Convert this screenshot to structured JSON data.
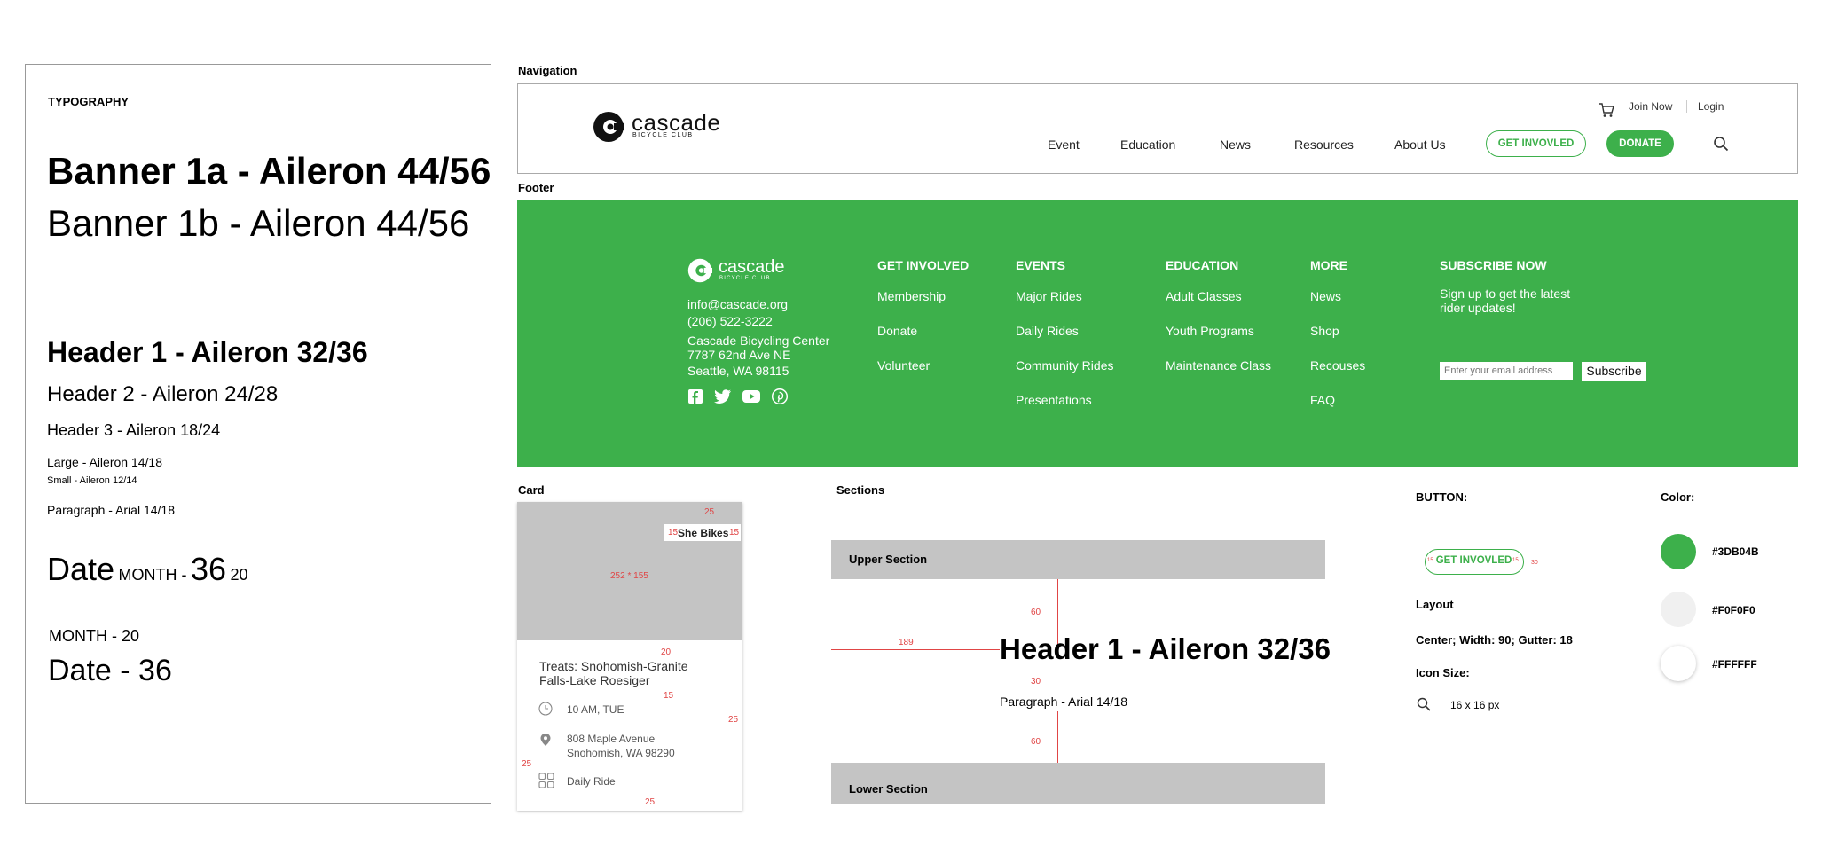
{
  "typography": {
    "title": "TYPOGRAPHY",
    "banner_1a": "Banner 1a - Aileron 44/56",
    "banner_1b": "Banner 1b - Aileron 44/56",
    "header_1": "Header 1 - Aileron 32/36",
    "header_2": "Header 2 - Aileron 24/28",
    "header_3": "Header 3 - Aileron 18/24",
    "large": "Large - Aileron 14/18",
    "small": "Small - Aileron 12/14",
    "paragraph": "Paragraph - Arial 14/18",
    "date_a": {
      "date": "Date",
      "month": "MONTH -",
      "day": "36",
      "year": "20"
    },
    "date_b": {
      "month_line": "MONTH - 20",
      "date_line": "Date - 36"
    }
  },
  "navigation": {
    "section_label": "Navigation",
    "logo_word": "cascade",
    "logo_sub": "BICYCLE CLUB",
    "join_now": "Join Now",
    "login": "Login",
    "items": [
      "Event",
      "Education",
      "News",
      "Resources",
      "About Us"
    ],
    "get_involved": "GET INVOVLED",
    "donate": "DONATE"
  },
  "footer": {
    "section_label": "Footer",
    "logo_word": "cascade",
    "logo_sub": "BICYCLE CLUB",
    "email": "info@cascade.org",
    "phone": "(206) 522-3222",
    "address_1": "Cascade Bicycling Center",
    "address_2": "7787 62nd Ave NE",
    "address_3": "Seattle, WA 98115",
    "columns": [
      {
        "heading": "GET INVOLVED",
        "links": [
          "Membership",
          "Donate",
          "Volunteer"
        ]
      },
      {
        "heading": "EVENTS",
        "links": [
          "Major Rides",
          "Daily Rides",
          "Community Rides",
          "Presentations"
        ]
      },
      {
        "heading": "EDUCATION",
        "links": [
          "Adult Classes",
          "Youth Programs",
          "Maintenance Class"
        ]
      },
      {
        "heading": "MORE",
        "links": [
          "News",
          "Shop",
          "Recouses",
          "FAQ"
        ]
      }
    ],
    "subscribe": {
      "heading": "SUBSCRIBE NOW",
      "text_1": "Sign up to get  the latest",
      "text_2": "rider updates!",
      "placeholder": "Enter your email address",
      "button": "Subscribe"
    },
    "social_icons": [
      "facebook-icon",
      "twitter-icon",
      "youtube-icon",
      "pinterest-icon"
    ]
  },
  "card": {
    "section_label": "Card",
    "tag": "She Bikes",
    "image_size": "252 * 155",
    "title_1": "Treats: Snohomish-Granite",
    "title_2": "Falls-Lake Roesiger",
    "time": "10 AM, TUE",
    "address_1": "808 Maple Avenue",
    "address_2": "Snohomish, WA 98290",
    "type": "Daily Ride",
    "spacing": {
      "top": "25",
      "tag_left": "15",
      "tag_right": "15",
      "below_image": "20",
      "title_gap": "15",
      "right": "25",
      "left": "25",
      "bottom": "25"
    }
  },
  "sections": {
    "section_label": "Sections",
    "upper": "Upper Section",
    "lower": "Lower Section",
    "heading": "Header 1 - Aileron 32/36",
    "paragraph": "Paragraph - Arial 14/18",
    "spacing": {
      "top": "60",
      "left": "189",
      "middle": "30",
      "bottom": "60"
    }
  },
  "button_spec": {
    "label": "BUTTON:",
    "sample": "GET INVOVLED",
    "pad_left": "15",
    "pad_right": "15",
    "height": "30",
    "layout_label": "Layout",
    "layout_value": "Center; Width: 90; Gutter: 18",
    "icon_size_label": "Icon Size:",
    "icon_size_value": "16 x 16 px"
  },
  "colors": {
    "label": "Color:",
    "swatches": [
      {
        "hex": "#3DB04B",
        "label": "#3DB04B"
      },
      {
        "hex": "#F0F0F0",
        "label": "#F0F0F0"
      },
      {
        "hex": "#FFFFFF",
        "label": "#FFFFFF"
      }
    ]
  }
}
